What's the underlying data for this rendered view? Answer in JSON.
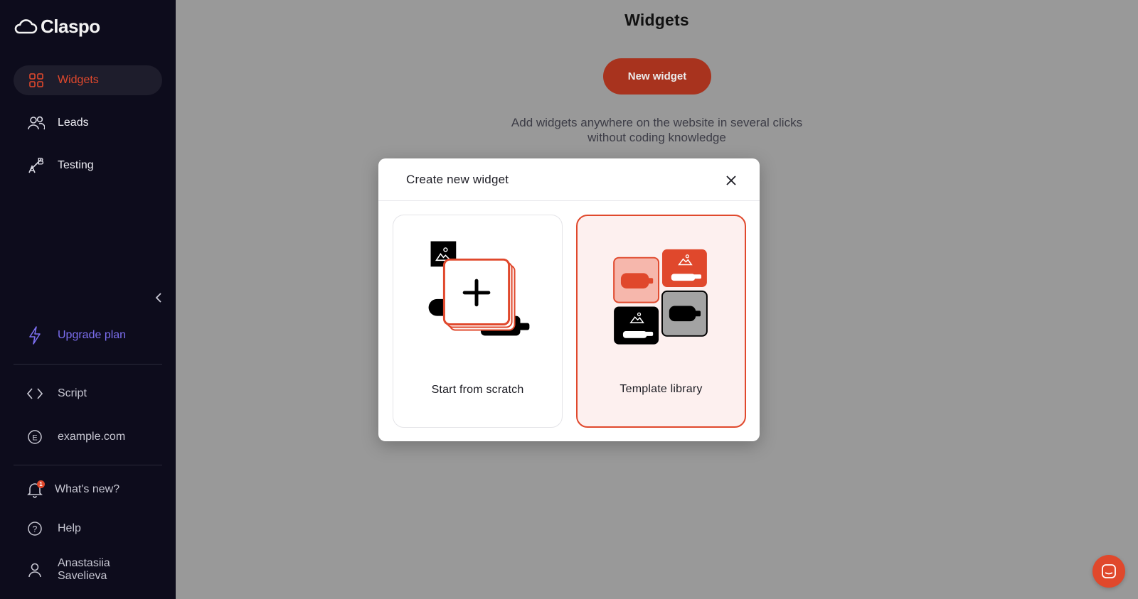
{
  "app": {
    "logo_text": "Claspo"
  },
  "sidebar": {
    "nav": [
      {
        "label": "Widgets",
        "icon": "grid-icon",
        "active": true
      },
      {
        "label": "Leads",
        "icon": "users-icon",
        "active": false
      },
      {
        "label": "Testing",
        "icon": "ab-test-icon",
        "active": false
      }
    ],
    "upgrade_label": "Upgrade plan",
    "script_label": "Script",
    "site_label": "example.com",
    "whats_new_label": "What's new?",
    "whats_new_badge": "1",
    "help_label": "Help",
    "user_name_line1": "Anastasiia",
    "user_name_line2": "Savelieva"
  },
  "main": {
    "title": "Widgets",
    "new_widget_label": "New widget",
    "description_line1": "Add widgets anywhere on the website in several clicks",
    "description_line2": "without coding knowledge"
  },
  "modal": {
    "title": "Create new widget",
    "options": [
      {
        "label": "Start from scratch",
        "selected": false
      },
      {
        "label": "Template library",
        "selected": true
      }
    ]
  },
  "colors": {
    "accent": "#e0482c",
    "sidebar_bg": "#0d0c1c",
    "upgrade": "#7c6ff0",
    "overlay_bg": "#999999"
  }
}
